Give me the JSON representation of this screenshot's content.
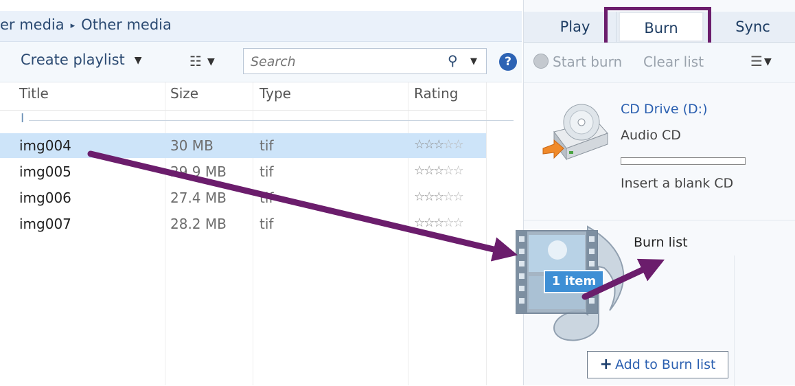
{
  "breadcrumb": {
    "items": [
      "er media",
      "Other media"
    ],
    "separator": "▸"
  },
  "toolbar": {
    "create_playlist_label": "Create playlist",
    "caret": "▼",
    "view_options_glyph": "☷",
    "search": {
      "placeholder": "Search",
      "icon_glyph": "⚲",
      "caret": "▼"
    },
    "help_glyph": "?"
  },
  "table": {
    "columns": [
      "Title",
      "Size",
      "Type",
      "Rating"
    ],
    "group_label": "I",
    "rows": [
      {
        "title": "img004",
        "size": "30 MB",
        "type": "tif",
        "rating": 3,
        "selected": true
      },
      {
        "title": "img005",
        "size": "29.9 MB",
        "type": "tif",
        "rating": 3,
        "selected": false
      },
      {
        "title": "img006",
        "size": "27.4 MB",
        "type": "tif",
        "rating": 3,
        "selected": false
      },
      {
        "title": "img007",
        "size": "28.2 MB",
        "type": "tif",
        "rating": 3,
        "selected": false
      }
    ],
    "max_rating": 5
  },
  "tabs": {
    "play": "Play",
    "burn": "Burn",
    "sync": "Sync",
    "active": "Burn"
  },
  "burn_toolbar": {
    "start_burn_label": "Start burn",
    "clear_list_label": "Clear list",
    "list_options_glyph": "☰",
    "caret": "▼"
  },
  "device": {
    "drive_label": "CD Drive (D:)",
    "disc_type": "Audio CD",
    "progress": 0,
    "status": "Insert a blank CD"
  },
  "burn_list": {
    "title": "Burn list",
    "add_label": "Add to Burn list",
    "add_glyph": "+",
    "drag_badge": "1 item"
  },
  "colors": {
    "annotation_arrow": "#6b1d6c",
    "selection": "#cde4f9",
    "link": "#2a5fb0",
    "badge": "#3e8fd5"
  }
}
